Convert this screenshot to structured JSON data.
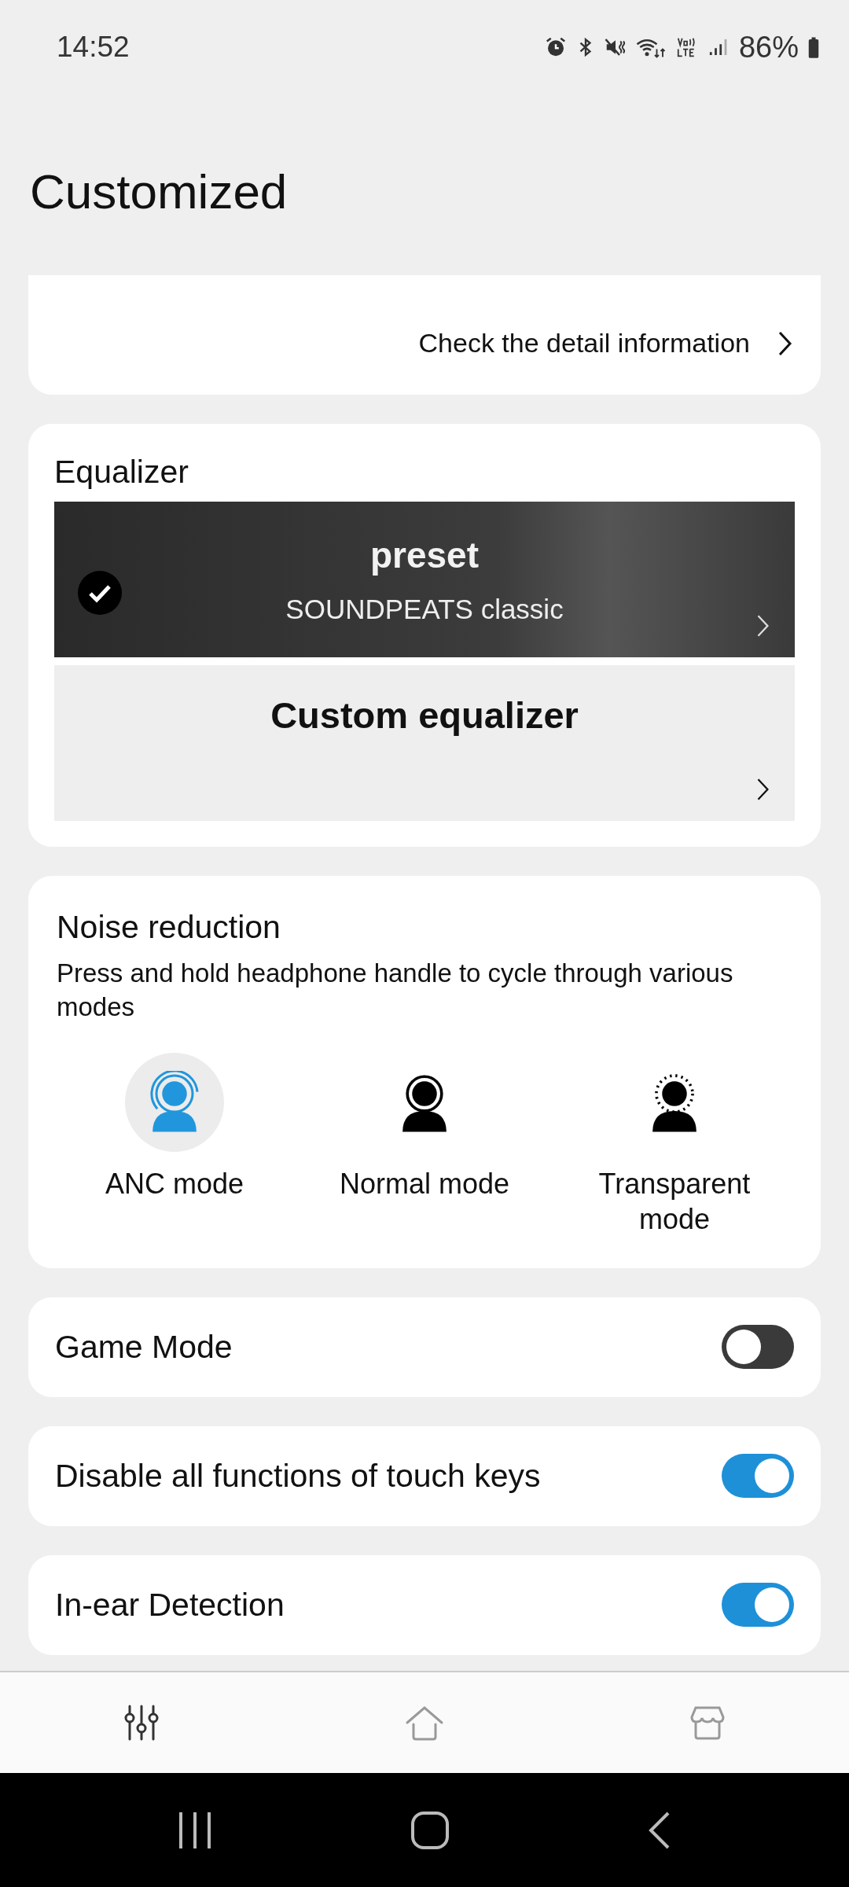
{
  "status_bar": {
    "time": "14:52",
    "battery": "86%"
  },
  "header": {
    "title": "Customized"
  },
  "adaptive_eq_card": {
    "link": "Check the detail information"
  },
  "equalizer": {
    "title": "Equalizer",
    "options": [
      {
        "kind": "preset",
        "title": "preset",
        "subtitle": "SOUNDPEATS classic",
        "selected": true
      },
      {
        "kind": "custom",
        "title": "Custom equalizer",
        "selected": false
      }
    ]
  },
  "noise_reduction": {
    "title": "Noise reduction",
    "description": "Press and hold headphone handle to cycle through various modes",
    "modes": [
      {
        "kind": "anc",
        "label": "ANC mode",
        "selected": true
      },
      {
        "kind": "normal",
        "label": "Normal mode",
        "selected": false
      },
      {
        "kind": "transparent",
        "label": "Transparent mode",
        "selected": false
      }
    ]
  },
  "settings": [
    {
      "label": "Game Mode",
      "on": false
    },
    {
      "label": "Disable all functions of touch keys",
      "on": true
    },
    {
      "label": "In-ear Detection",
      "on": true
    }
  ],
  "bottom_nav": [
    {
      "kind": "equalizer",
      "selected": true
    },
    {
      "kind": "home",
      "selected": false
    },
    {
      "kind": "store",
      "selected": false
    }
  ]
}
